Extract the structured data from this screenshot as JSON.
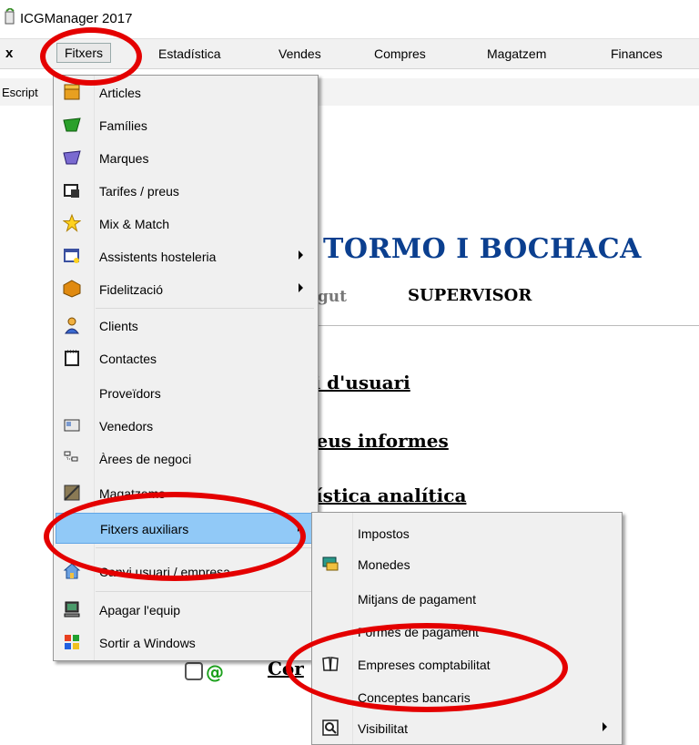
{
  "window": {
    "title": "ICGManager 2017"
  },
  "menubar": {
    "close": "x",
    "items": [
      "Fitxers",
      "Estadística",
      "Vendes",
      "Compres",
      "Magatzem",
      "Finances"
    ]
  },
  "toolbar": {
    "label": "Escript"
  },
  "background": {
    "company": "TORMO I BOCHACA",
    "subtitle_grey": "ingut",
    "role": "SUPERVISOR",
    "links": [
      "vi d'usuari",
      "neus informes",
      "dística analítica"
    ],
    "bottom_link": "Cor"
  },
  "fitxers_menu": {
    "items": [
      {
        "label": "Articles",
        "icon": "box-icon"
      },
      {
        "label": "Famílies",
        "icon": "green-folder-icon"
      },
      {
        "label": "Marques",
        "icon": "purple-folder-icon"
      },
      {
        "label": "Tarifes / preus",
        "icon": "price-tag-icon"
      },
      {
        "label": "Mix & Match",
        "icon": "star-icon"
      },
      {
        "label": "Assistents hosteleria",
        "icon": "wizard-icon",
        "submenu": true
      },
      {
        "label": "Fidelització",
        "icon": "loyalty-box-icon",
        "submenu": true
      },
      {
        "label": "Clients",
        "icon": "person-icon"
      },
      {
        "label": "Contactes",
        "icon": "notepad-icon"
      },
      {
        "label": "Proveïdors",
        "icon": ""
      },
      {
        "label": "Venedors",
        "icon": "id-card-icon"
      },
      {
        "label": "Àrees de negoci",
        "icon": "tree-icon"
      },
      {
        "label": "Magatzems",
        "icon": "warehouse-icon"
      },
      {
        "label": "Fitxers auxiliars",
        "icon": "",
        "submenu": true,
        "highlighted": true
      },
      {
        "label": "Canvi usuari / empresa",
        "icon": "home-icon"
      },
      {
        "label": "Apagar l'equip",
        "icon": "computer-icon"
      },
      {
        "label": "Sortir a Windows",
        "icon": "windows-icon"
      }
    ]
  },
  "aux_submenu": {
    "items": [
      {
        "label": "Impostos",
        "icon": ""
      },
      {
        "label": "Monedes",
        "icon": "currency-icon"
      },
      {
        "label": "Mitjans de pagament",
        "icon": ""
      },
      {
        "label": "Formes de pagament",
        "icon": ""
      },
      {
        "label": "Empreses comptabilitat",
        "icon": "book-icon"
      },
      {
        "label": "Conceptes bancaris",
        "icon": ""
      },
      {
        "label": "Visibilitat",
        "icon": "magnifier-icon",
        "submenu": true
      }
    ]
  },
  "colors": {
    "highlight": "#91c9f7",
    "annotation": "#e40000",
    "company": "#0b3f8f"
  }
}
